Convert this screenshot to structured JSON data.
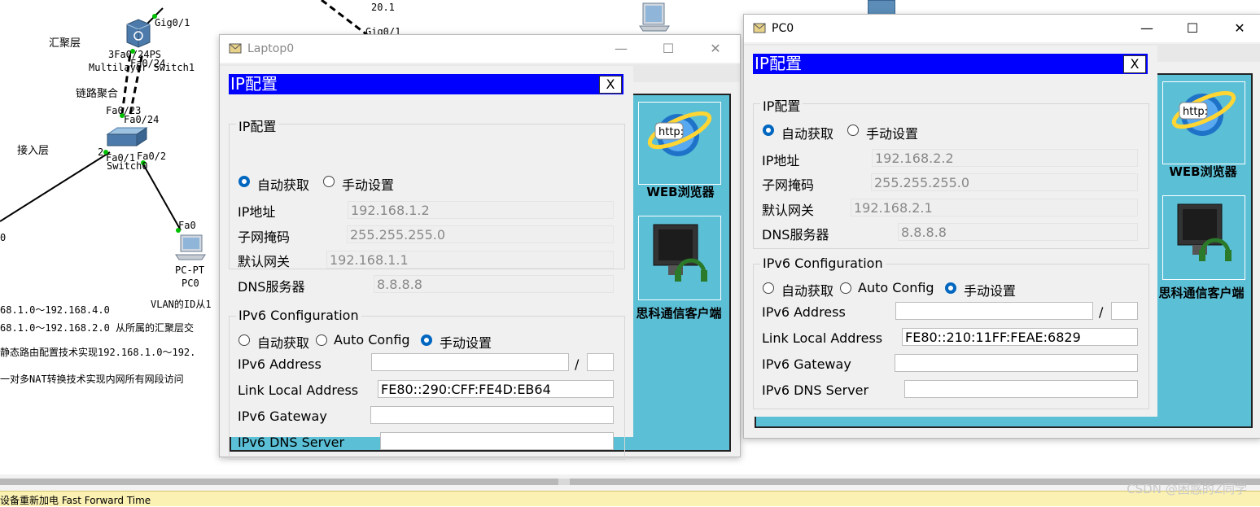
{
  "topology": {
    "labels": {
      "aggregation": "汇聚层",
      "link_agg": "链路聚合",
      "access": "接入层",
      "ms_gig01": "Gig0/1",
      "ms_name_a": "3Fa0/24PS",
      "ms_name_b": "Multilayer Switch1",
      "ms_fa024": "Fa0/24",
      "sw_fa023": "Fa0/23",
      "sw_fa024": "Fa0/24",
      "sw_left": "2",
      "sw_fa01": "Fa0/1",
      "sw_fa02": "Fa0/2",
      "sw_name": "Switch0",
      "pc_fa0": "Fa0",
      "pc_type": "PC-PT",
      "pc_name": "PC0",
      "ip_top": "20.1",
      "gig_top": "Gig0/1",
      "left_zero": "0"
    },
    "notes": [
      "68.1.0～192.168.4.0",
      "68.1.0～192.168.2.0 从所属的汇聚层交",
      "静态路由配置技术实现192.168.1.0～192.",
      "一对多NAT转换技术实现内网所有网段访问",
      "VLAN的ID从1"
    ]
  },
  "status_bar": {
    "text": "设备重新加电  Fast Forward Time",
    "watermark": "CSDN @困惑的Z同学"
  },
  "laptop_window": {
    "title": "Laptop0",
    "min": "—",
    "max": "☐",
    "close": "✕",
    "panel_title": "IP配置",
    "panel_close": "X",
    "ipv4_group": "IP配置",
    "dhcp": "自动获取",
    "static": "手动设置",
    "ip_label": "IP地址",
    "ip_value": "192.168.1.2",
    "mask_label": "子网掩码",
    "mask_value": "255.255.255.0",
    "gw_label": "默认网关",
    "gw_value": "192.168.1.1",
    "dns_label": "DNS服务器",
    "dns_value": "8.8.8.8",
    "ipv6_group": "IPv6 Configuration",
    "v6_auto": "自动获取",
    "v6_autoconfig": "Auto Config",
    "v6_manual": "手动设置",
    "v6_addr_label": "IPv6 Address",
    "v6_addr_value": "",
    "v6_slash": "/",
    "v6_prefix": "",
    "link_local_label": "Link Local Address",
    "link_local_value": "FE80::290:CFF:FE4D:EB64",
    "v6_gw_label": "IPv6 Gateway",
    "v6_gw_value": "",
    "v6_dns_label": "IPv6 DNS Server",
    "v6_dns_value": "",
    "web_tile": "WEB浏览器",
    "cisco_tile": "思科通信客户端",
    "http_text": "http:"
  },
  "pc_window": {
    "title": "PC0",
    "min": "—",
    "max": "☐",
    "close": "✕",
    "panel_title": "IP配置",
    "panel_close": "X",
    "ipv4_group": "IP配置",
    "dhcp": "自动获取",
    "static": "手动设置",
    "ip_label": "IP地址",
    "ip_value": "192.168.2.2",
    "mask_label": "子网掩码",
    "mask_value": "255.255.255.0",
    "gw_label": "默认网关",
    "gw_value": "192.168.2.1",
    "dns_label": "DNS服务器",
    "dns_value": "8.8.8.8",
    "ipv6_group": "IPv6 Configuration",
    "v6_auto": "自动获取",
    "v6_autoconfig": "Auto Config",
    "v6_manual": "手动设置",
    "v6_addr_label": "IPv6 Address",
    "v6_addr_value": "",
    "v6_slash": "/",
    "v6_prefix": "",
    "link_local_label": "Link Local Address",
    "link_local_value": "FE80::210:11FF:FEAE:6829",
    "v6_gw_label": "IPv6 Gateway",
    "v6_gw_value": "",
    "v6_dns_label": "IPv6 DNS Server",
    "v6_dns_value": "",
    "web_tile": "WEB浏览器",
    "cisco_tile": "思科通信客户端",
    "http_text": "http:"
  }
}
